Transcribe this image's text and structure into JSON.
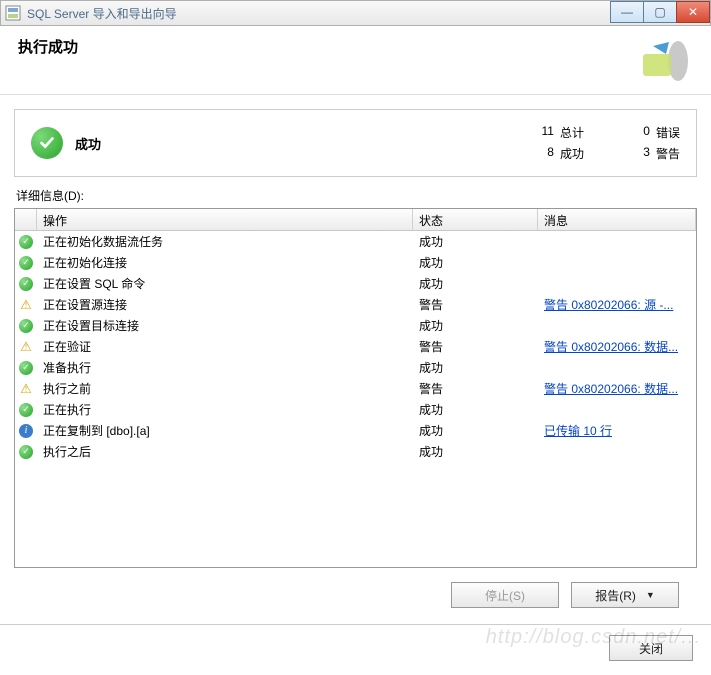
{
  "window": {
    "title": "SQL Server 导入和导出向导"
  },
  "header": {
    "title": "执行成功"
  },
  "status": {
    "label": "成功",
    "total_n": "11",
    "total_l": "总计",
    "error_n": "0",
    "error_l": "错误",
    "ok_n": "8",
    "ok_l": "成功",
    "warn_n": "3",
    "warn_l": "警告"
  },
  "detail_label": "详细信息(D):",
  "columns": {
    "c1": "操作",
    "c2": "状态",
    "c3": "消息"
  },
  "rows": [
    {
      "icon": "ok",
      "op": "正在初始化数据流任务",
      "st": "成功",
      "msg": ""
    },
    {
      "icon": "ok",
      "op": "正在初始化连接",
      "st": "成功",
      "msg": ""
    },
    {
      "icon": "ok",
      "op": "正在设置 SQL 命令",
      "st": "成功",
      "msg": ""
    },
    {
      "icon": "warn",
      "op": "正在设置源连接",
      "st": "警告",
      "msg": "警告 0x80202066: 源 -..."
    },
    {
      "icon": "ok",
      "op": "正在设置目标连接",
      "st": "成功",
      "msg": ""
    },
    {
      "icon": "warn",
      "op": "正在验证",
      "st": "警告",
      "msg": "警告 0x80202066: 数据..."
    },
    {
      "icon": "ok",
      "op": "准备执行",
      "st": "成功",
      "msg": ""
    },
    {
      "icon": "warn",
      "op": "执行之前",
      "st": "警告",
      "msg": "警告 0x80202066: 数据..."
    },
    {
      "icon": "ok",
      "op": "正在执行",
      "st": "成功",
      "msg": ""
    },
    {
      "icon": "info",
      "op": "正在复制到 [dbo].[a]",
      "st": "成功",
      "msg": "已传输 10 行"
    },
    {
      "icon": "ok",
      "op": "执行之后",
      "st": "成功",
      "msg": ""
    }
  ],
  "buttons": {
    "stop": "停止(S)",
    "report": "报告(R)",
    "close": "关闭"
  },
  "watermark": "http://blog.csdn.net/..."
}
